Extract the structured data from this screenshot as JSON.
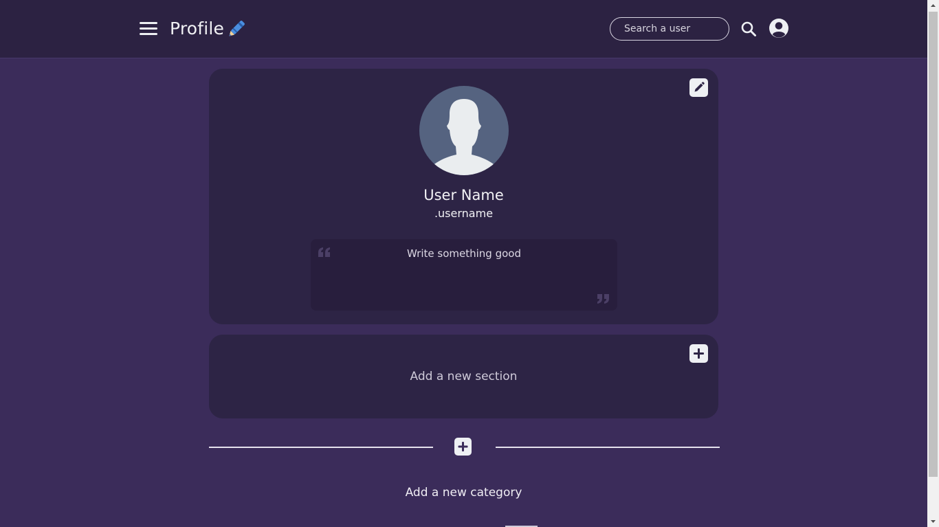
{
  "header": {
    "title": "Profile",
    "search_placeholder": "Search a user"
  },
  "profile": {
    "display_name": "User Name",
    "handle": ".username",
    "bio_placeholder": "Write something good"
  },
  "sections": {
    "add_section_label": "Add a new section"
  },
  "categories": {
    "add_category_label": "Add a new category"
  },
  "colors": {
    "page_background": "#3b2c5a",
    "header_background": "#2c2242",
    "card_background": "#2d2445",
    "bio_background": "#281e3d",
    "avatar_background": "#556380",
    "icon_light": "#eef0f3"
  },
  "icons": {
    "menu": "hamburger-menu-icon",
    "title_decoration": "crayon-icon",
    "search": "search-icon",
    "account": "user-circle-icon",
    "edit": "pencil-icon",
    "add": "plus-icon",
    "quote_open": "quote-open-icon",
    "quote_close": "quote-close-icon"
  }
}
